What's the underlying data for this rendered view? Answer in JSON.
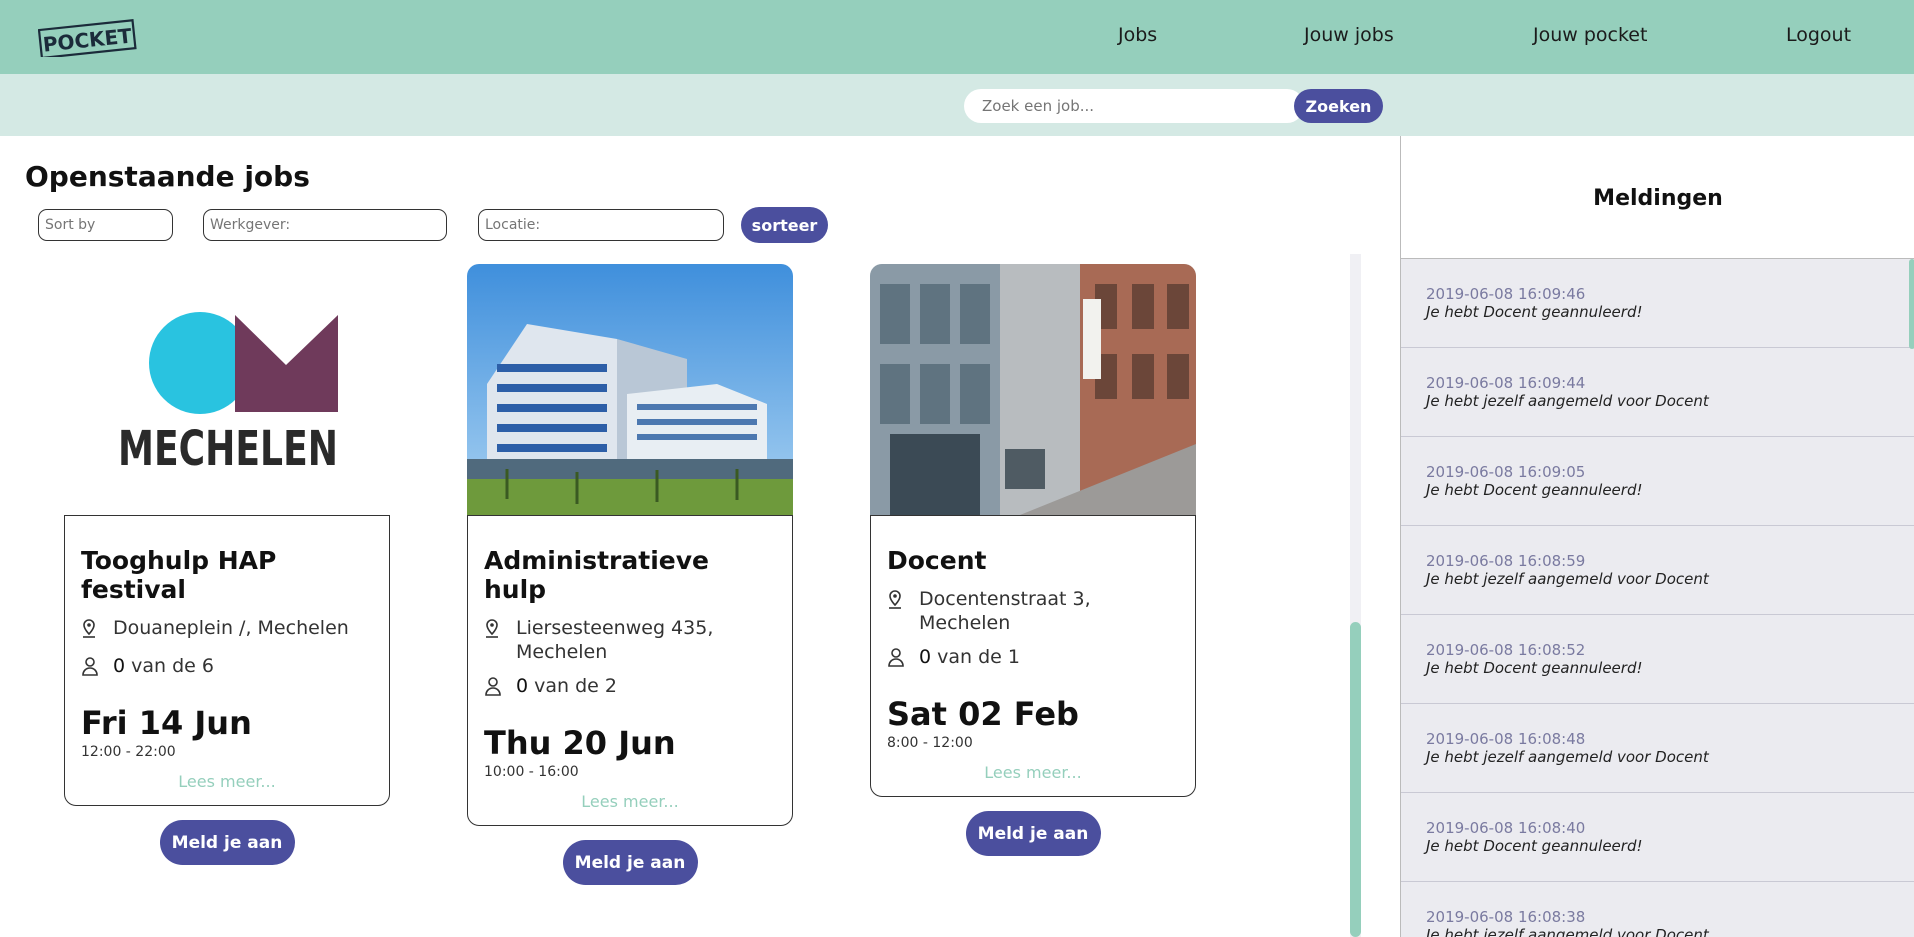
{
  "header": {
    "logo_text": "POCKET",
    "nav": [
      "Jobs",
      "Jouw jobs",
      "Jouw pocket",
      "Logout"
    ]
  },
  "search": {
    "placeholder": "Zoek een job...",
    "button": "Zoeken"
  },
  "main": {
    "title": "Openstaande jobs",
    "filters": {
      "sort_placeholder": "Sort by",
      "employer_placeholder": "Werkgever:",
      "location_placeholder": "Locatie:",
      "sort_button": "sorteer"
    },
    "jobs": [
      {
        "logo_text": "MECHELEN",
        "title": "Tooghulp HAP festival",
        "address": "Douaneplein /, Mechelen",
        "filled": "0",
        "capacity_text": "van de 6",
        "date": "Fri 14 Jun",
        "time": "12:00 - 22:00",
        "more": "Lees meer...",
        "apply": "Meld je aan"
      },
      {
        "title": "Administratieve hulp",
        "address": "Liersesteenweg 435, Mechelen",
        "filled": "0",
        "capacity_text": "van de 2",
        "date": "Thu 20 Jun",
        "time": "10:00 - 16:00",
        "more": "Lees meer...",
        "apply": "Meld je aan"
      },
      {
        "title": "Docent",
        "address": "Docentenstraat 3, Mechelen",
        "filled": "0",
        "capacity_text": "van de 1",
        "date": "Sat 02 Feb",
        "time": "8:00 - 12:00",
        "more": "Lees meer...",
        "apply": "Meld je aan"
      }
    ]
  },
  "notifications": {
    "title": "Meldingen",
    "items": [
      {
        "time": "2019-06-08 16:09:46",
        "text": "Je hebt Docent geannuleerd!"
      },
      {
        "time": "2019-06-08 16:09:44",
        "text": "Je hebt jezelf aangemeld voor Docent"
      },
      {
        "time": "2019-06-08 16:09:05",
        "text": "Je hebt Docent geannuleerd!"
      },
      {
        "time": "2019-06-08 16:08:59",
        "text": "Je hebt jezelf aangemeld voor Docent"
      },
      {
        "time": "2019-06-08 16:08:52",
        "text": "Je hebt Docent geannuleerd!"
      },
      {
        "time": "2019-06-08 16:08:48",
        "text": "Je hebt jezelf aangemeld voor Docent"
      },
      {
        "time": "2019-06-08 16:08:40",
        "text": "Je hebt Docent geannuleerd!"
      },
      {
        "time": "2019-06-08 16:08:38",
        "text": "Je hebt jezelf aangemeld voor Docent"
      }
    ]
  },
  "colors": {
    "header_bg": "#95cfbc",
    "searchbar_bg": "#d4e9e4",
    "accent": "#4b4f9e",
    "link": "#95cfbc",
    "notif_bg": "#ebebf0"
  }
}
